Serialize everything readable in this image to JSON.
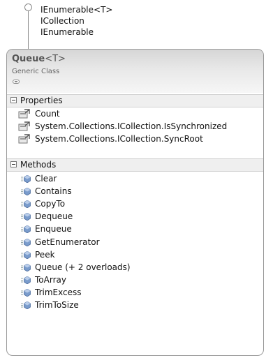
{
  "interfaces": [
    "IEnumerable<T>",
    "ICollection",
    "IEnumerable"
  ],
  "class": {
    "name": "Queue",
    "type_param": "<T>",
    "kind": "Generic Class"
  },
  "properties": {
    "label": "Properties",
    "items": [
      "Count",
      "System.Collections.ICollection.IsSynchronized",
      "System.Collections.ICollection.SyncRoot"
    ]
  },
  "methods": {
    "label": "Methods",
    "items": [
      "Clear",
      "Contains",
      "CopyTo",
      "Dequeue",
      "Enqueue",
      "GetEnumerator",
      "Peek",
      "Queue (+ 2 overloads)",
      "ToArray",
      "TrimExcess",
      "TrimToSize"
    ]
  },
  "colors": {
    "header_gradient_top": "#d6d6d6",
    "border": "#9a9a9a",
    "method_icon": "#6f8fbf",
    "property_icon": "#7a7a7a"
  },
  "icons": {
    "interface": "lollipop-icon",
    "property": "property-icon",
    "method": "method-icon",
    "collapse": "chevron-up-icon",
    "compartment_toggle": "collapse-box-icon"
  }
}
